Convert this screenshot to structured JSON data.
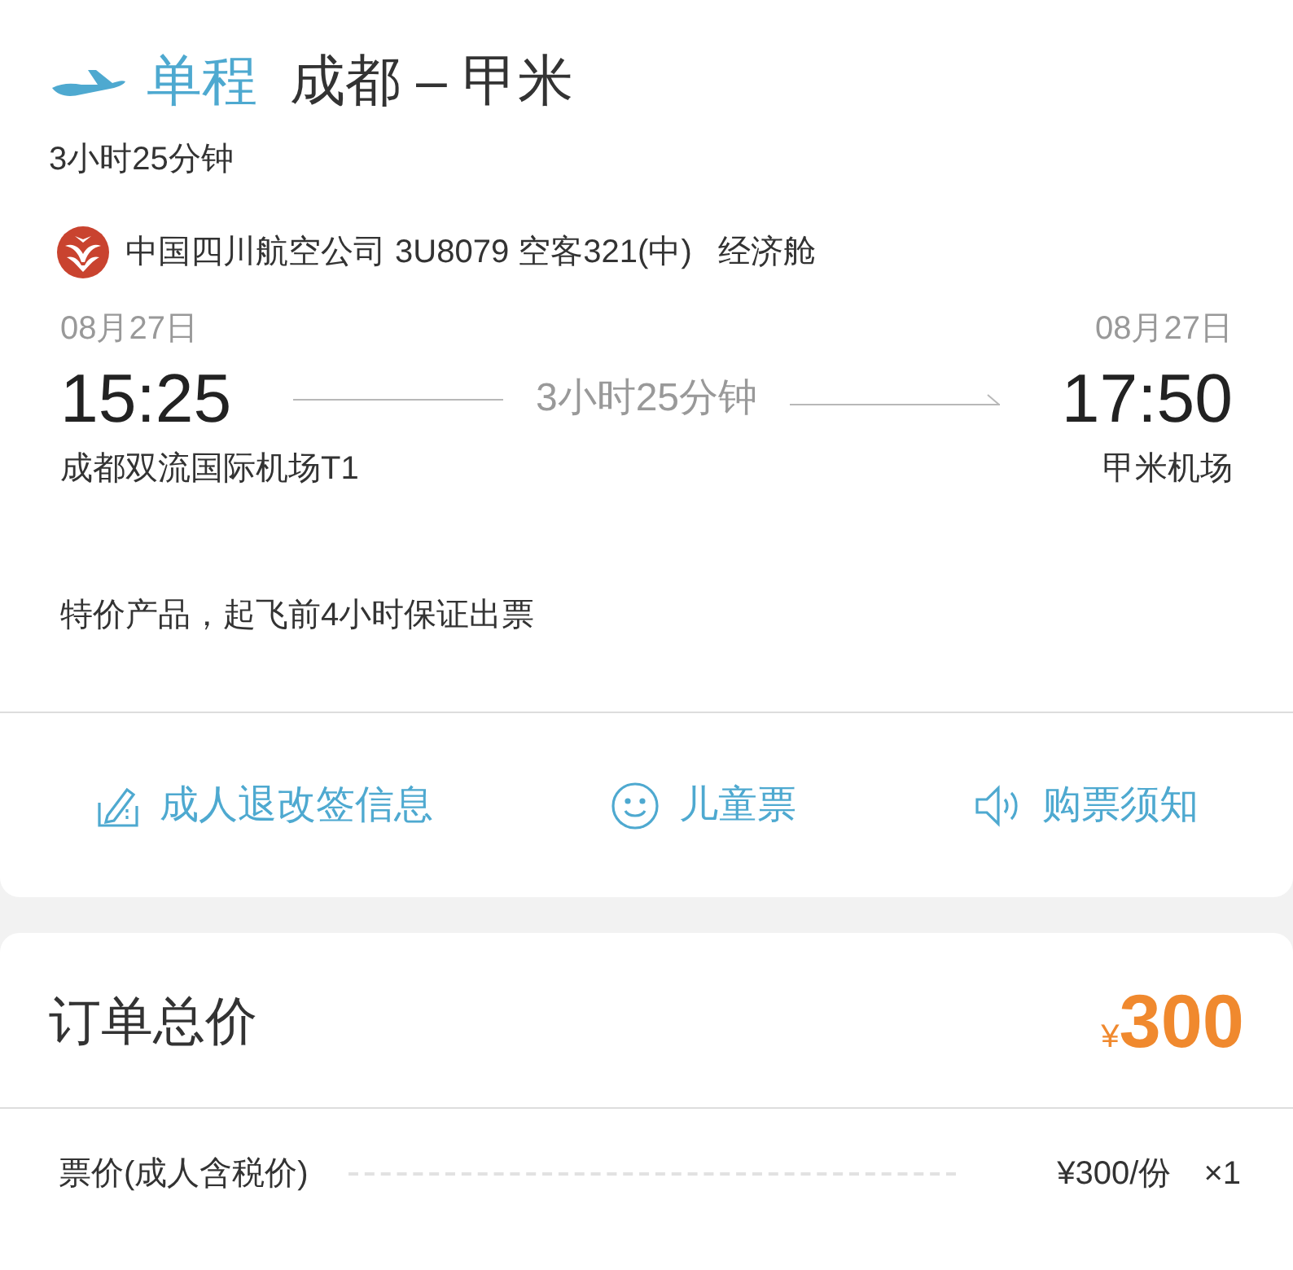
{
  "header": {
    "trip_type": "单程",
    "route": "成都 – 甲米",
    "duration": "3小时25分钟"
  },
  "flight": {
    "airline_info": "中国四川航空公司 3U8079 空客321(中)",
    "cabin": "经济舱",
    "departure": {
      "date": "08月27日",
      "time": "15:25",
      "airport": "成都双流国际机场T1"
    },
    "duration": "3小时25分钟",
    "arrival": {
      "date": "08月27日",
      "time": "17:50",
      "airport": "甲米机场"
    }
  },
  "notice": "特价产品，起飞前4小时保证出票",
  "links": [
    {
      "kind": "edit",
      "label": "成人退改签信息"
    },
    {
      "kind": "smile",
      "label": "儿童票"
    },
    {
      "kind": "speaker",
      "label": "购票须知"
    }
  ],
  "order": {
    "title": "订单总价",
    "currency": "¥",
    "total": "300"
  },
  "price_rows": [
    {
      "label": "票价(成人含税价)",
      "unit_price": "¥300/份",
      "quantity": "×1"
    }
  ]
}
